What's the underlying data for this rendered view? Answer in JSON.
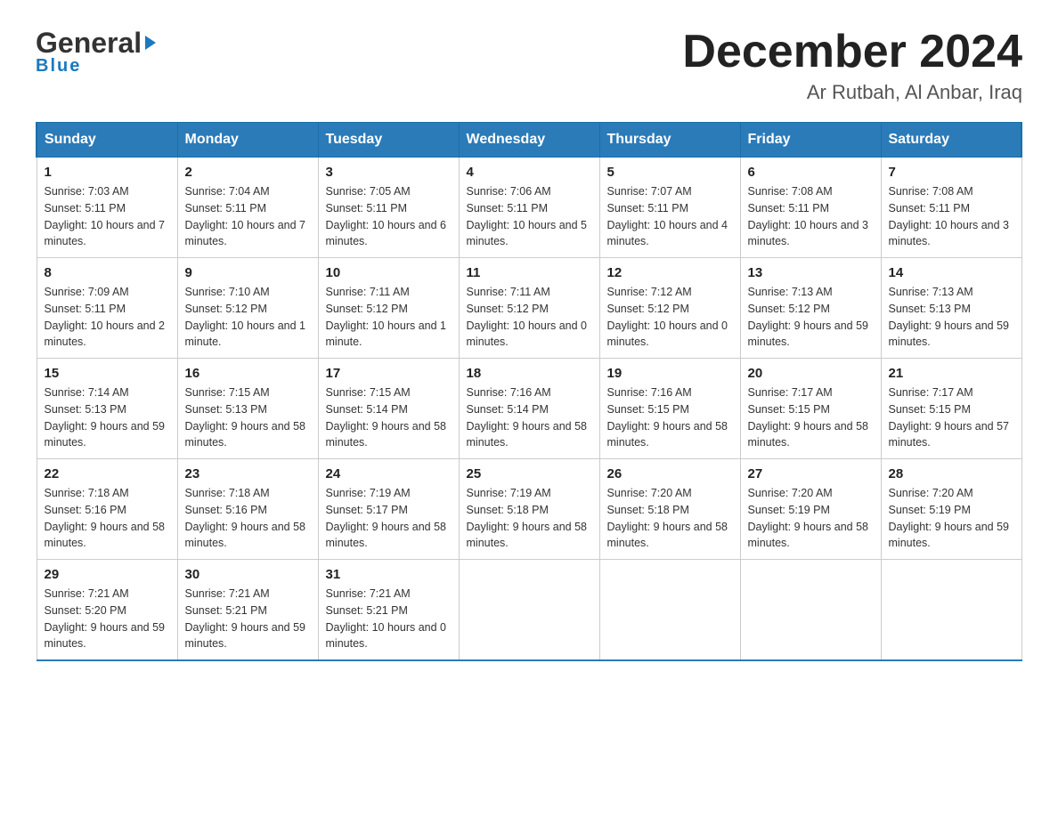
{
  "header": {
    "logo_general": "General",
    "logo_blue": "Blue",
    "month": "December 2024",
    "location": "Ar Rutbah, Al Anbar, Iraq"
  },
  "days_of_week": [
    "Sunday",
    "Monday",
    "Tuesday",
    "Wednesday",
    "Thursday",
    "Friday",
    "Saturday"
  ],
  "weeks": [
    [
      {
        "day": "1",
        "sunrise": "7:03 AM",
        "sunset": "5:11 PM",
        "daylight": "10 hours and 7 minutes."
      },
      {
        "day": "2",
        "sunrise": "7:04 AM",
        "sunset": "5:11 PM",
        "daylight": "10 hours and 7 minutes."
      },
      {
        "day": "3",
        "sunrise": "7:05 AM",
        "sunset": "5:11 PM",
        "daylight": "10 hours and 6 minutes."
      },
      {
        "day": "4",
        "sunrise": "7:06 AM",
        "sunset": "5:11 PM",
        "daylight": "10 hours and 5 minutes."
      },
      {
        "day": "5",
        "sunrise": "7:07 AM",
        "sunset": "5:11 PM",
        "daylight": "10 hours and 4 minutes."
      },
      {
        "day": "6",
        "sunrise": "7:08 AM",
        "sunset": "5:11 PM",
        "daylight": "10 hours and 3 minutes."
      },
      {
        "day": "7",
        "sunrise": "7:08 AM",
        "sunset": "5:11 PM",
        "daylight": "10 hours and 3 minutes."
      }
    ],
    [
      {
        "day": "8",
        "sunrise": "7:09 AM",
        "sunset": "5:11 PM",
        "daylight": "10 hours and 2 minutes."
      },
      {
        "day": "9",
        "sunrise": "7:10 AM",
        "sunset": "5:12 PM",
        "daylight": "10 hours and 1 minute."
      },
      {
        "day": "10",
        "sunrise": "7:11 AM",
        "sunset": "5:12 PM",
        "daylight": "10 hours and 1 minute."
      },
      {
        "day": "11",
        "sunrise": "7:11 AM",
        "sunset": "5:12 PM",
        "daylight": "10 hours and 0 minutes."
      },
      {
        "day": "12",
        "sunrise": "7:12 AM",
        "sunset": "5:12 PM",
        "daylight": "10 hours and 0 minutes."
      },
      {
        "day": "13",
        "sunrise": "7:13 AM",
        "sunset": "5:12 PM",
        "daylight": "9 hours and 59 minutes."
      },
      {
        "day": "14",
        "sunrise": "7:13 AM",
        "sunset": "5:13 PM",
        "daylight": "9 hours and 59 minutes."
      }
    ],
    [
      {
        "day": "15",
        "sunrise": "7:14 AM",
        "sunset": "5:13 PM",
        "daylight": "9 hours and 59 minutes."
      },
      {
        "day": "16",
        "sunrise": "7:15 AM",
        "sunset": "5:13 PM",
        "daylight": "9 hours and 58 minutes."
      },
      {
        "day": "17",
        "sunrise": "7:15 AM",
        "sunset": "5:14 PM",
        "daylight": "9 hours and 58 minutes."
      },
      {
        "day": "18",
        "sunrise": "7:16 AM",
        "sunset": "5:14 PM",
        "daylight": "9 hours and 58 minutes."
      },
      {
        "day": "19",
        "sunrise": "7:16 AM",
        "sunset": "5:15 PM",
        "daylight": "9 hours and 58 minutes."
      },
      {
        "day": "20",
        "sunrise": "7:17 AM",
        "sunset": "5:15 PM",
        "daylight": "9 hours and 58 minutes."
      },
      {
        "day": "21",
        "sunrise": "7:17 AM",
        "sunset": "5:15 PM",
        "daylight": "9 hours and 57 minutes."
      }
    ],
    [
      {
        "day": "22",
        "sunrise": "7:18 AM",
        "sunset": "5:16 PM",
        "daylight": "9 hours and 58 minutes."
      },
      {
        "day": "23",
        "sunrise": "7:18 AM",
        "sunset": "5:16 PM",
        "daylight": "9 hours and 58 minutes."
      },
      {
        "day": "24",
        "sunrise": "7:19 AM",
        "sunset": "5:17 PM",
        "daylight": "9 hours and 58 minutes."
      },
      {
        "day": "25",
        "sunrise": "7:19 AM",
        "sunset": "5:18 PM",
        "daylight": "9 hours and 58 minutes."
      },
      {
        "day": "26",
        "sunrise": "7:20 AM",
        "sunset": "5:18 PM",
        "daylight": "9 hours and 58 minutes."
      },
      {
        "day": "27",
        "sunrise": "7:20 AM",
        "sunset": "5:19 PM",
        "daylight": "9 hours and 58 minutes."
      },
      {
        "day": "28",
        "sunrise": "7:20 AM",
        "sunset": "5:19 PM",
        "daylight": "9 hours and 59 minutes."
      }
    ],
    [
      {
        "day": "29",
        "sunrise": "7:21 AM",
        "sunset": "5:20 PM",
        "daylight": "9 hours and 59 minutes."
      },
      {
        "day": "30",
        "sunrise": "7:21 AM",
        "sunset": "5:21 PM",
        "daylight": "9 hours and 59 minutes."
      },
      {
        "day": "31",
        "sunrise": "7:21 AM",
        "sunset": "5:21 PM",
        "daylight": "10 hours and 0 minutes."
      },
      {
        "day": "",
        "sunrise": "",
        "sunset": "",
        "daylight": ""
      },
      {
        "day": "",
        "sunrise": "",
        "sunset": "",
        "daylight": ""
      },
      {
        "day": "",
        "sunrise": "",
        "sunset": "",
        "daylight": ""
      },
      {
        "day": "",
        "sunrise": "",
        "sunset": "",
        "daylight": ""
      }
    ]
  ],
  "labels": {
    "sunrise_prefix": "Sunrise: ",
    "sunset_prefix": "Sunset: ",
    "daylight_prefix": "Daylight: "
  }
}
